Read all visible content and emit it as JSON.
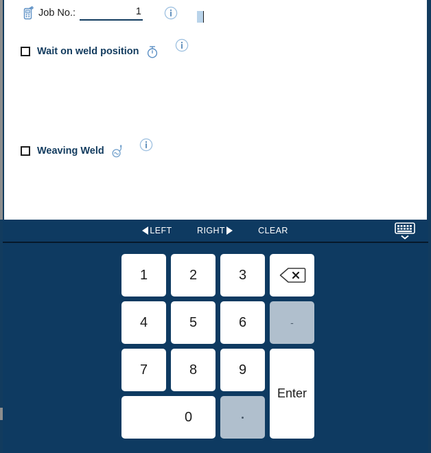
{
  "form": {
    "job": {
      "icon": "job-device-icon",
      "label": "Job No.:",
      "value": "1",
      "placeholder": "",
      "info_icon": "info-circle-icon"
    },
    "wait_on_weld_position": {
      "label": "Wait on weld position",
      "checked": false,
      "trail_icon": "stopwatch-icon",
      "info_icon": "info-circle-icon"
    },
    "weaving_weld": {
      "label": "Weaving Weld",
      "checked": false,
      "trail_icon": "weaving-weld-icon",
      "info_icon": "info-circle-icon"
    }
  },
  "toolbar": {
    "left_label": "LEFT",
    "right_label": "RIGHT",
    "clear_label": "CLEAR",
    "keyboard_icon": "hide-keyboard-icon"
  },
  "keypad": {
    "keys": [
      {
        "label": "1",
        "name": "key-1",
        "style": "plain"
      },
      {
        "label": "2",
        "name": "key-2",
        "style": "plain"
      },
      {
        "label": "3",
        "name": "key-3",
        "style": "plain"
      },
      {
        "label": "",
        "name": "key-backspace",
        "style": "icon-backspace"
      },
      {
        "label": "4",
        "name": "key-4",
        "style": "plain"
      },
      {
        "label": "5",
        "name": "key-5",
        "style": "plain"
      },
      {
        "label": "6",
        "name": "key-6",
        "style": "plain"
      },
      {
        "label": "-",
        "name": "key-minus",
        "style": "muted"
      },
      {
        "label": "7",
        "name": "key-7",
        "style": "plain"
      },
      {
        "label": "8",
        "name": "key-8",
        "style": "plain"
      },
      {
        "label": "9",
        "name": "key-9",
        "style": "plain"
      },
      {
        "label": "Enter",
        "name": "key-enter",
        "style": "tall"
      },
      {
        "label": "0",
        "name": "key-0",
        "style": "wide"
      },
      {
        "label": ".",
        "name": "key-decimal",
        "style": "muted-dot"
      }
    ]
  },
  "colors": {
    "panel_bg": "#ffffff",
    "chrome_blue": "#0e3a61",
    "accent_dark": "#123b5e",
    "key_face": "#ffffff",
    "key_muted": "#b0bfcd",
    "selection": "#b9d3ea"
  }
}
